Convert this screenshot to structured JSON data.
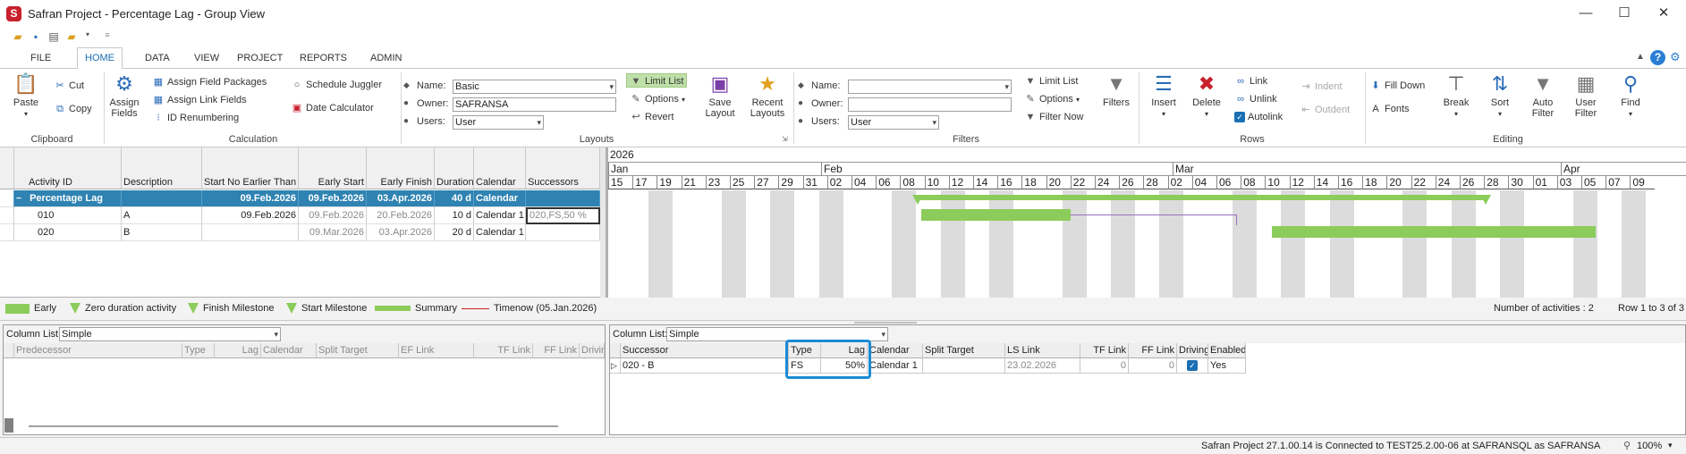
{
  "window": {
    "title": "Safran Project - Percentage Lag - Group View",
    "logo": "S"
  },
  "menu": {
    "tabs": [
      "FILE",
      "HOME",
      "DATA",
      "VIEW",
      "PROJECT",
      "REPORTS",
      "ADMIN"
    ],
    "active": "HOME"
  },
  "ribbon": {
    "clipboard": {
      "paste": "Paste",
      "cut": "Cut",
      "copy": "Copy",
      "label": "Clipboard"
    },
    "calculation": {
      "assign_fields": "Assign Fields",
      "assign_field_packages": "Assign Field Packages",
      "assign_link_fields": "Assign Link Fields",
      "id_renumbering": "ID Renumbering",
      "schedule_juggler": "Schedule Juggler",
      "date_calculator": "Date Calculator",
      "label": "Calculation"
    },
    "layouts": {
      "name_label": "Name:",
      "name_value": "Basic",
      "owner_label": "Owner:",
      "owner_value": "SAFRANSA",
      "users_label": "Users:",
      "users_value": "User",
      "limit_list": "Limit List",
      "options": "Options",
      "revert": "Revert",
      "save_layout": "Save Layout",
      "recent_layouts": "Recent Layouts",
      "label": "Layouts"
    },
    "filters": {
      "name_label": "Name:",
      "name_value": "",
      "owner_label": "Owner:",
      "owner_value": "",
      "users_label": "Users:",
      "users_value": "User",
      "limit_list": "Limit List",
      "options": "Options",
      "filter_now": "Filter Now",
      "filters": "Filters",
      "label": "Filters"
    },
    "rows": {
      "insert": "Insert",
      "delete": "Delete",
      "link": "Link",
      "unlink": "Unlink",
      "autolink": "Autolink",
      "indent": "Indent",
      "outdent": "Outdent",
      "label": "Rows"
    },
    "editing": {
      "fill_down": "Fill Down",
      "fonts": "Fonts",
      "break": "Break",
      "sort": "Sort",
      "auto_filter": "Auto Filter",
      "user_filter": "User Filter",
      "find": "Find",
      "label": "Editing"
    }
  },
  "grid": {
    "headers": [
      "Activity ID",
      "Description",
      "Start No Earlier Than",
      "Early Start",
      "Early Finish",
      "Duration",
      "Calendar",
      "Successors"
    ],
    "summary": {
      "toggle": "−",
      "id": "Percentage Lag",
      "description": "",
      "snet": "09.Feb.2026",
      "early_start": "09.Feb.2026",
      "early_finish": "03.Apr.2026",
      "duration": "40 d",
      "calendar": "Calendar",
      "successors": ""
    },
    "rows": [
      {
        "id": "010",
        "description": "A",
        "snet": "09.Feb.2026",
        "early_start": "09.Feb.2026",
        "early_finish": "20.Feb.2026",
        "duration": "10 d",
        "calendar": "Calendar 1",
        "successors": "020,FS,50 %"
      },
      {
        "id": "020",
        "description": "B",
        "snet": "",
        "early_start": "09.Mar.2026",
        "early_finish": "03.Apr.2026",
        "duration": "20 d",
        "calendar": "Calendar 1",
        "successors": ""
      }
    ]
  },
  "gantt": {
    "year": "2026",
    "months": [
      "Jan",
      "Feb",
      "Mar",
      "Apr"
    ],
    "days": [
      "15",
      "17",
      "19",
      "21",
      "23",
      "25",
      "27",
      "29",
      "31",
      "02",
      "04",
      "06",
      "08",
      "10",
      "12",
      "14",
      "16",
      "18",
      "20",
      "22",
      "24",
      "26",
      "28",
      "02",
      "04",
      "06",
      "08",
      "10",
      "12",
      "14",
      "16",
      "18",
      "20",
      "22",
      "24",
      "26",
      "28",
      "30",
      "01",
      "03",
      "05",
      "07",
      "09"
    ]
  },
  "legend": {
    "items": [
      "Early",
      "Zero duration activity",
      "Finish Milestone",
      "Start Milestone",
      "Summary",
      "Timenow (05.Jan.2026)"
    ],
    "count": "Number of activities : 2",
    "rows": "Row 1 to 3 of 3"
  },
  "pred_pane": {
    "column_list_label": "Column List:",
    "column_list_value": "Simple",
    "headers": [
      "Predecessor",
      "Type",
      "Lag",
      "Calendar",
      "Split Target",
      "EF Link",
      "TF Link",
      "FF Link",
      "Driving"
    ]
  },
  "succ_pane": {
    "column_list_label": "Column List:",
    "column_list_value": "Simple",
    "headers": [
      "Successor",
      "Type",
      "Lag",
      "Calendar",
      "Split Target",
      "LS Link",
      "TF Link",
      "FF Link",
      "Driving",
      "Enabled"
    ],
    "row": {
      "successor": "020 - B",
      "type": "FS",
      "lag": "50%",
      "calendar": "Calendar 1",
      "split_target": "",
      "ls_link": "23.02.2026",
      "tf_link": "0",
      "ff_link": "0",
      "driving": "✓",
      "enabled": "Yes"
    }
  },
  "status": {
    "text": "Safran Project 27.1.00.14 is Connected to TEST25.2.00-06 at SAFRANSQL as SAFRANSA",
    "zoom": "100%"
  },
  "colors": {
    "accent": "#1a8ad4",
    "summary_row": "#2f83b2",
    "bar": "#8ccc5b",
    "highlight_box": "#1a8ad4"
  }
}
